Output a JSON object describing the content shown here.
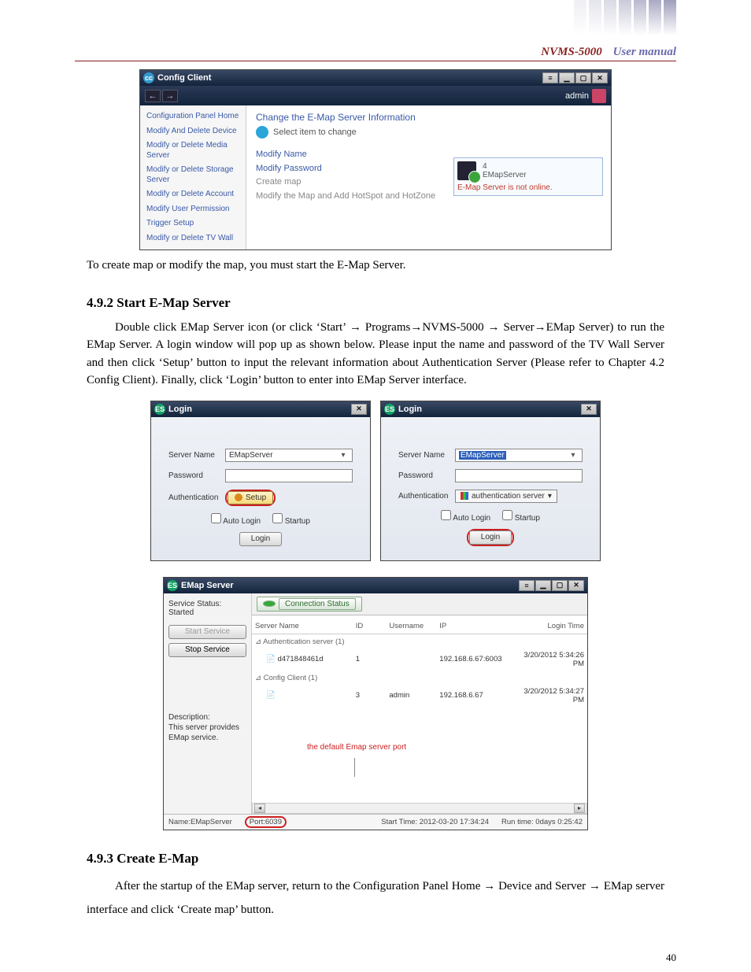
{
  "header": {
    "product": "NVMS-5000",
    "label": "User manual"
  },
  "configClient": {
    "title": "Config Client",
    "user": "admin",
    "sideItems": [
      "Configuration Panel Home",
      "Modify And Delete Device",
      "Modify or Delete Media Server",
      "Modify or Delete Storage Server",
      "Modify or Delete Account",
      "Modify User Permission",
      "Trigger Setup",
      "Modify or Delete TV Wall"
    ],
    "heading": "Change the E-Map Server Information",
    "selectPrompt": "Select item to change",
    "links": {
      "modifyName": "Modify Name",
      "modifyPassword": "Modify Password",
      "createMap": "Create map",
      "modifyMap": "Modify the Map and Add HotSpot and HotZone"
    },
    "status": {
      "count": "4",
      "name": "EMapServer",
      "warn": "E-Map Server is not online."
    }
  },
  "para1": "To create map or modify the map, you must start the E-Map Server.",
  "sect492": "4.9.2 Start E-Map Server",
  "para2": "Double click EMap Server icon (or click ‘Start’ → Programs→NVMS-5000 → Server→EMap Server) to run the EMap Server. A login window will pop up as shown below. Please input the name and password of the TV Wall Server and then click ‘Setup’ button to input the relevant information about Authentication Server (Please refer to Chapter 4.2 Config Client). Finally, click ‘Login’ button to enter into EMap Server interface.",
  "login": {
    "title": "Login",
    "serverLabel": "Server Name",
    "serverValue": "EMapServer",
    "passwordLabel": "Password",
    "authLabel": "Authentication",
    "setup": "Setup",
    "authServer": "authentication server",
    "cbAuto": "Auto Login",
    "cbStartup": "Startup",
    "loginBtn": "Login"
  },
  "emapServer": {
    "title": "EMap Server",
    "serviceStatus": "Service Status: Started",
    "startBtn": "Start Service",
    "stopBtn": "Stop Service",
    "descTitle": "Description:",
    "descBody": "This server provides EMap service.",
    "tab": "Connection Status",
    "cols": {
      "serverName": "Server Name",
      "id": "ID",
      "username": "Username",
      "ip": "IP",
      "loginTime": "Login Time"
    },
    "groups": {
      "auth": "Authentication server (1)",
      "cfg": "Config Client (1)"
    },
    "rows": [
      {
        "name": "d471848461d",
        "id": "1",
        "user": "",
        "ip": "192.168.6.67:6003",
        "time": "3/20/2012  5:34:26 PM"
      },
      {
        "name": "",
        "id": "3",
        "user": "admin",
        "ip": "192.168.6.67",
        "time": "3/20/2012  5:34:27 PM"
      }
    ],
    "portNote": "the default Emap server port",
    "foot": {
      "name": "Name:EMapServer",
      "port": "Port:6039",
      "start": "Start Time: 2012-03-20 17:34:24",
      "run": "Run time: 0days 0:25:42"
    }
  },
  "sect493": "4.9.3 Create E-Map",
  "para3": "After the startup of the EMap server, return to the Configuration Panel Home → Device and Server → EMap server interface and click ‘Create map’ button.",
  "pageNum": "40"
}
